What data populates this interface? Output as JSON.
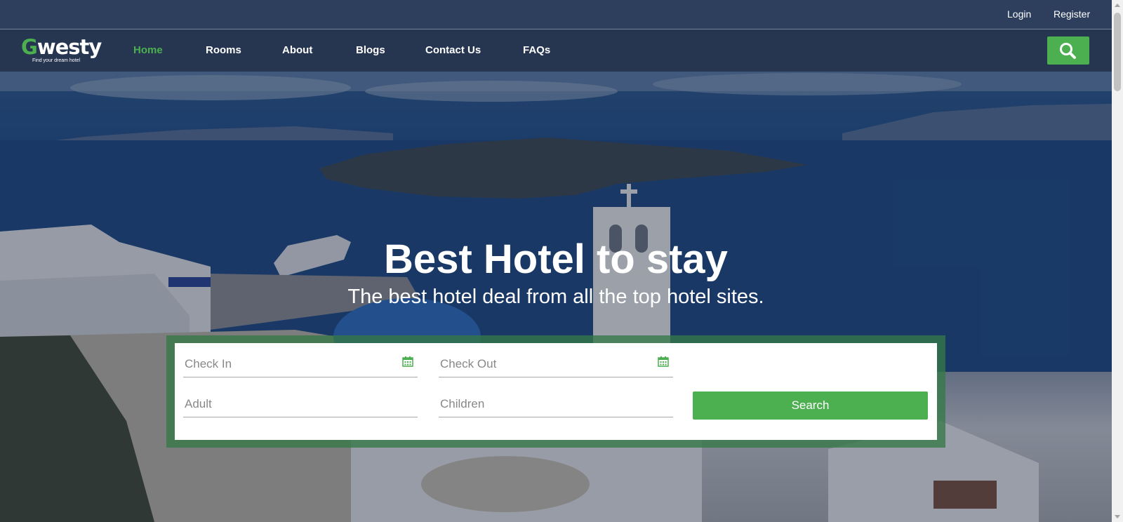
{
  "topbar": {
    "login": "Login",
    "register": "Register"
  },
  "brand": {
    "name_first": "G",
    "name_rest": "westy",
    "tagline": "Find your dream hotel"
  },
  "nav": {
    "items": [
      {
        "label": "Home",
        "active": true
      },
      {
        "label": "Rooms"
      },
      {
        "label": "About"
      },
      {
        "label": "Blogs"
      },
      {
        "label": "Contact Us"
      },
      {
        "label": "FAQs"
      }
    ]
  },
  "hero": {
    "title": "Best Hotel to stay",
    "subtitle": "The best hotel deal from all the top hotel sites."
  },
  "booking": {
    "check_in": "Check In",
    "check_out": "Check Out",
    "adult": "Adult",
    "children": "Children",
    "search": "Search"
  },
  "colors": {
    "accent": "#4caf50",
    "nav_bg": "#1e2a42"
  },
  "icons": {
    "search": "search-icon",
    "calendar": "calendar-icon"
  }
}
